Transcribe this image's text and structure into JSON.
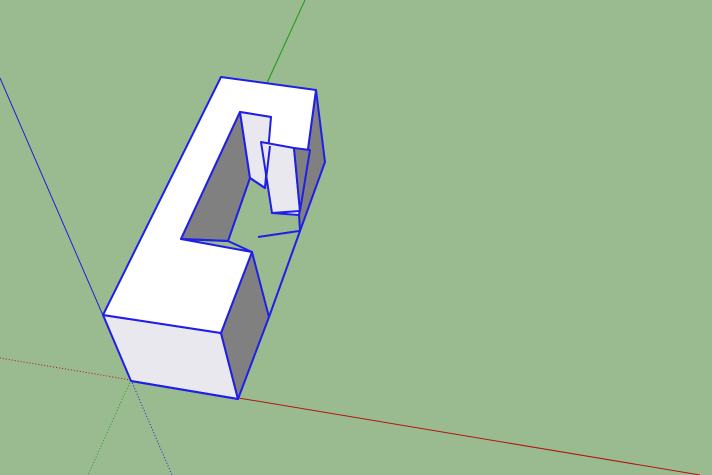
{
  "viewport": {
    "background": "#9abb8f",
    "edge_color": "#1f1fe6",
    "face_top": "#ffffff",
    "face_side_light": "#e8e8ee",
    "face_side_dark": "#808080"
  },
  "axes": {
    "red": "#b01515",
    "green": "#1a9a1a",
    "blue": "#1f1fd6"
  },
  "model": {
    "selected": true,
    "shape": "C-shaped extruded block"
  }
}
